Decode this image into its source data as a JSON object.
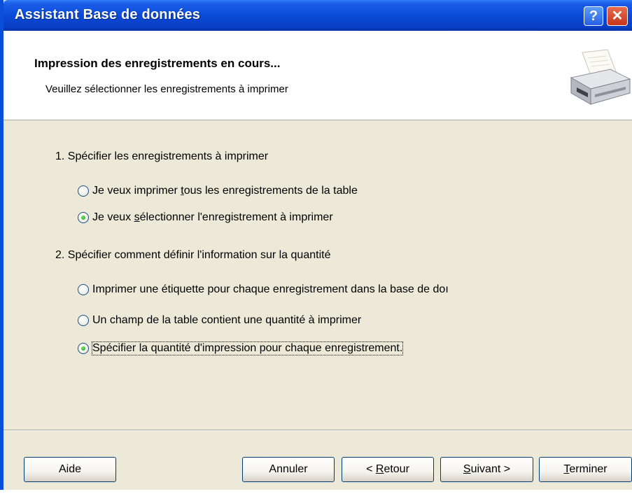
{
  "window": {
    "title": "Assistant Base de données",
    "help_button": "?",
    "close_button": "✕"
  },
  "header": {
    "title": "Impression des enregistrements en cours...",
    "subtitle": "Veuillez sélectionner les enregistrements à imprimer",
    "icon": "printer-icon"
  },
  "section1": {
    "label": "1. Spécifier les enregistrements à imprimer",
    "options": [
      {
        "pre": "Je veux imprimer ",
        "mn": "t",
        "post": "ous les enregistrements de la table",
        "checked": false
      },
      {
        "pre": "Je veux ",
        "mn": "s",
        "post": "électionner l'enregistrement à imprimer",
        "checked": true
      }
    ]
  },
  "section2": {
    "label": "2. Spécifier comment définir l'information sur la quantité",
    "options": [
      {
        "label": "Imprimer une étiquette pour chaque enregistrement dans la base de doı",
        "checked": false
      },
      {
        "label": "Un champ de la table contient une quantité à imprimer",
        "checked": false
      },
      {
        "label": "Spécifier la quantité d'impression pour chaque enregistrement.",
        "checked": true
      }
    ]
  },
  "buttons": {
    "help": "Aide",
    "cancel": "Annuler",
    "back": {
      "pre": "< ",
      "mn": "R",
      "post": "etour"
    },
    "next": {
      "pre": "",
      "mn": "S",
      "post": "uivant >"
    },
    "finish": {
      "pre": "",
      "mn": "T",
      "post": "erminer"
    }
  },
  "colors": {
    "title_bar": "#0a4ad7",
    "dialog_background": "#ece9d8",
    "radio_checked": "#1f9d1c"
  }
}
